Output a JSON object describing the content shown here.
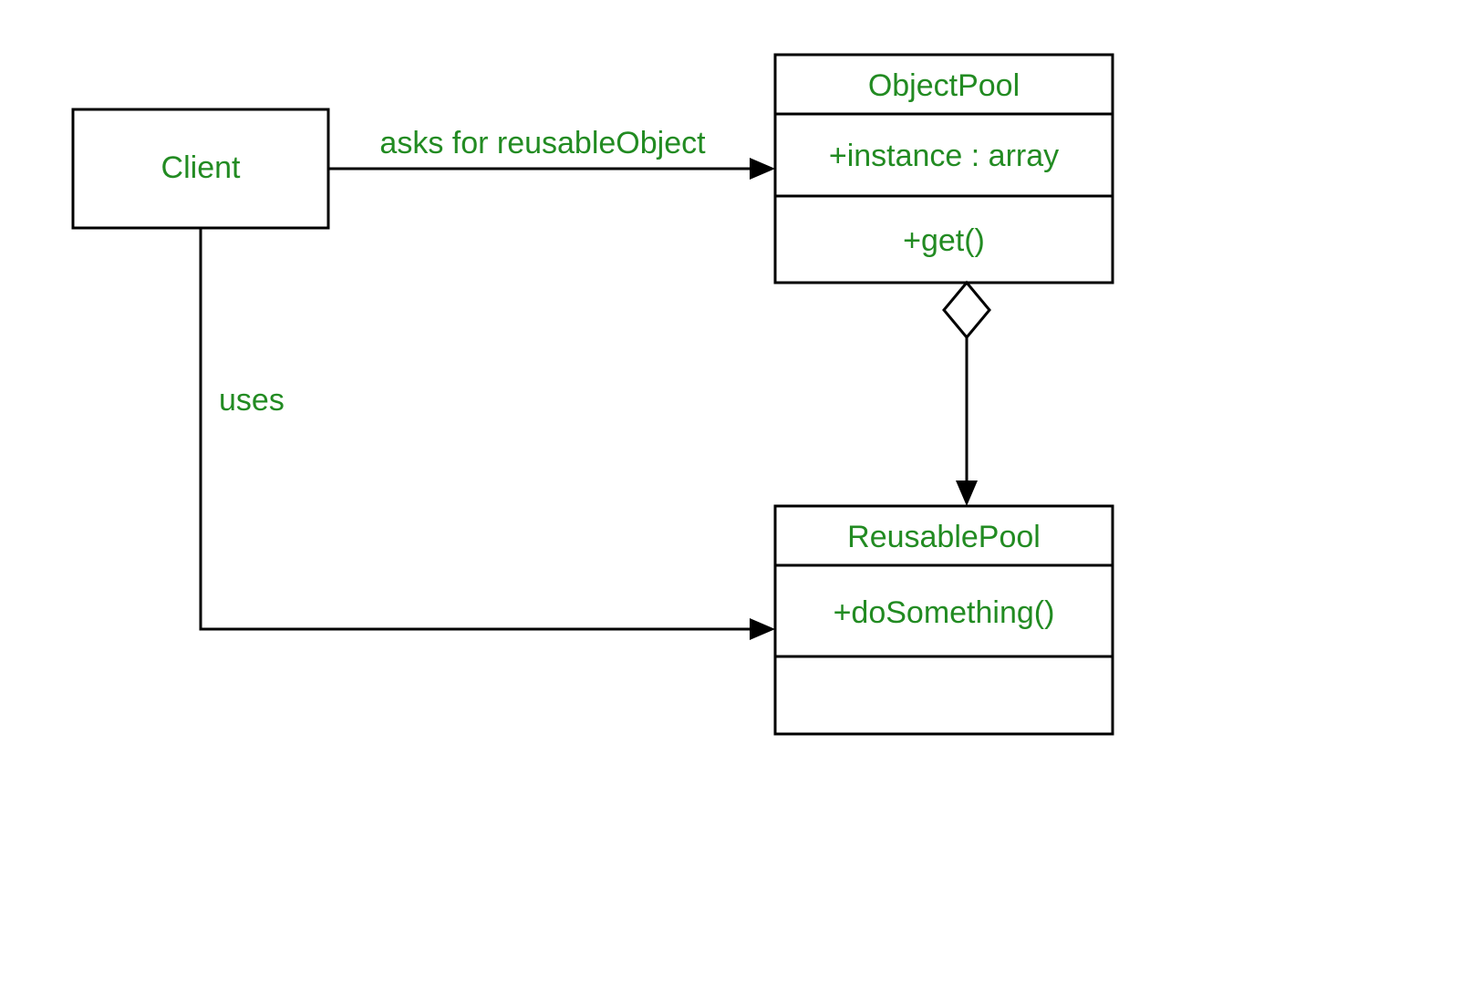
{
  "classes": {
    "client": {
      "name": "Client"
    },
    "objectPool": {
      "name": "ObjectPool",
      "attribute": "+instance : array",
      "method": "+get()"
    },
    "reusablePool": {
      "name": "ReusablePool",
      "method": "+doSomething()"
    }
  },
  "relations": {
    "asks": "asks for reusableObject",
    "uses": "uses"
  }
}
